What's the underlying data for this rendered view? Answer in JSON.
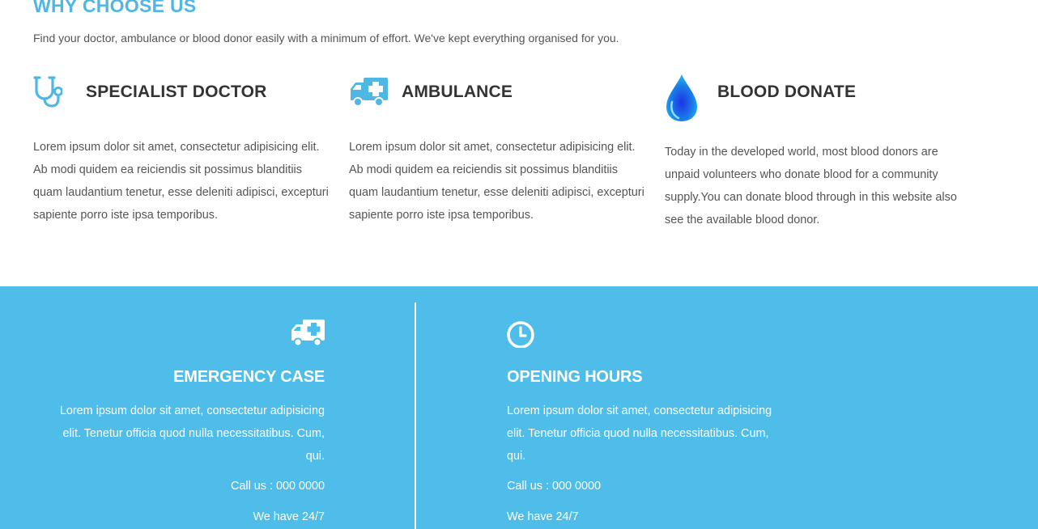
{
  "why": {
    "title": "WHY CHOOSE US",
    "subtitle": "Find your doctor, ambulance or blood donor easily with a minimum of effort. We've kept everything organised for you."
  },
  "features": [
    {
      "icon": "stethoscope-icon",
      "title": "SPECIALIST DOCTOR",
      "text": "Lorem ipsum dolor sit amet, consectetur adipisicing elit. Ab modi quidem ea reiciendis sit possimus blanditiis quam laudantium tenetur, esse deleniti adipisci, excepturi sapiente porro iste ipsa temporibus."
    },
    {
      "icon": "ambulance-icon",
      "title": "AMBULANCE",
      "text": "Lorem ipsum dolor sit amet, consectetur adipisicing elit. Ab modi quidem ea reiciendis sit possimus blanditiis quam laudantium tenetur, esse deleniti adipisci, excepturi sapiente porro iste ipsa temporibus."
    },
    {
      "icon": "blood-drop-icon",
      "title": "BLOOD DONATE",
      "text": "Today in the developed world, most blood donors are unpaid volunteers who donate blood for a community supply.You can donate blood through in this website also see the available blood donor."
    }
  ],
  "emergency": {
    "icon": "ambulance-icon",
    "title": "EMERGENCY CASE",
    "text": "Lorem ipsum dolor sit amet, consectetur adipisicing elit. Tenetur officia quod nulla necessitatibus. Cum, qui.",
    "call": "Call us : 000 0000",
    "hours": "We have 24/7"
  },
  "opening": {
    "icon": "clock-icon",
    "title": "OPENING HOURS",
    "text": "Lorem ipsum dolor sit amet, consectetur adipisicing elit. Tenetur officia quod nulla necessitatibus. Cum, qui.",
    "call": "Call us : 000 0000",
    "hours": "We have 24/7"
  },
  "colors": {
    "accent": "#4fb7e3",
    "band": "#4fbdea",
    "heading": "#333333",
    "body_text": "#555555"
  }
}
